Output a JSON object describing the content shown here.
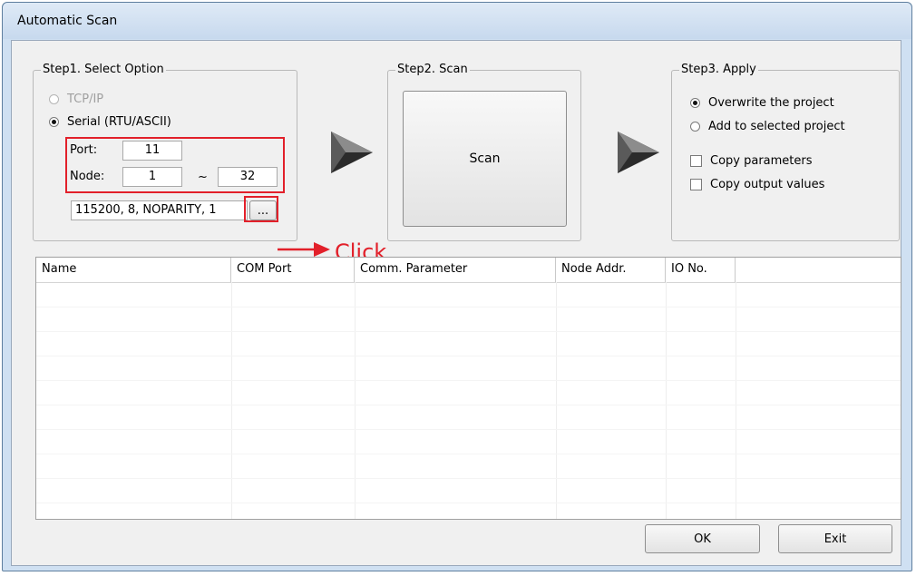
{
  "window": {
    "title": "Automatic Scan"
  },
  "step1": {
    "legend": "Step1. Select Option",
    "tcpip_label": "TCP/IP",
    "serial_label": "Serial (RTU/ASCII)",
    "port_label": "Port:",
    "port_value": "11",
    "node_label": "Node:",
    "node_from": "1",
    "range_sep": "~",
    "node_to": "32",
    "comm_params": "115200, 8, NOPARITY, 1",
    "browse_label": "..."
  },
  "step2": {
    "legend": "Step2. Scan",
    "scan_label": "Scan"
  },
  "step3": {
    "legend": "Step3. Apply",
    "overwrite_label": "Overwrite the project",
    "add_label": "Add to selected project",
    "copy_params_label": "Copy parameters",
    "copy_output_label": "Copy output values"
  },
  "annotation": {
    "click_label": "Click"
  },
  "table": {
    "columns": [
      "Name",
      "COM Port",
      "Comm. Parameter",
      "Node Addr.",
      "IO No."
    ],
    "rows": []
  },
  "buttons": {
    "ok_label": "OK",
    "exit_label": "Exit"
  },
  "colors": {
    "annotation": "#e2202a",
    "dialog_frame": "#cfe0f2"
  },
  "icons": {
    "step_arrow": "play-triangle-icon"
  }
}
